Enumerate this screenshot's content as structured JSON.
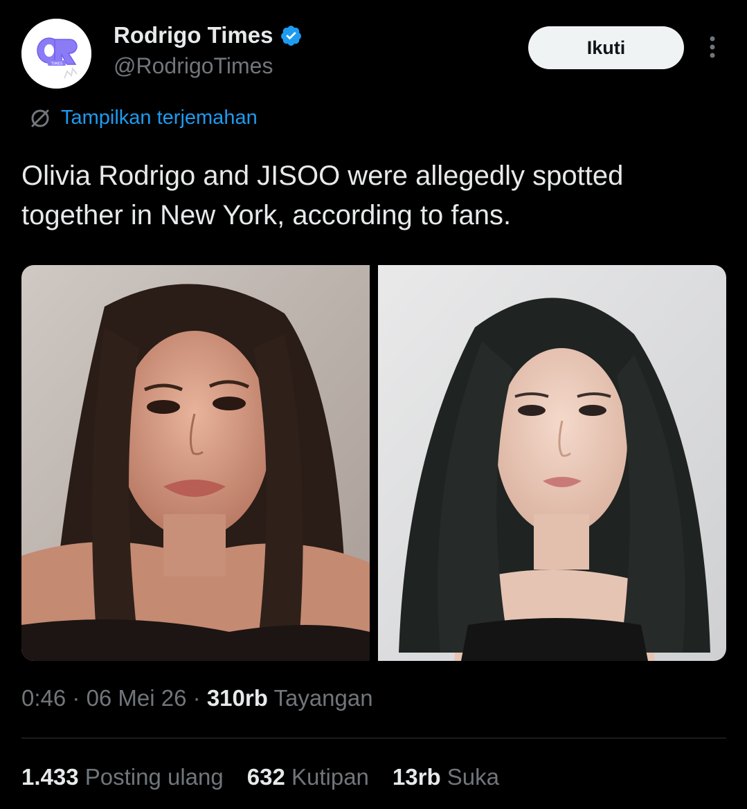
{
  "account": {
    "display_name": "Rodrigo Times",
    "handle": "@RodrigoTimes",
    "verified": true,
    "avatar_text": "OR",
    "avatar_subtext": "TIMES"
  },
  "actions": {
    "follow_label": "Ikuti",
    "more_icon": "more-vertical-icon"
  },
  "translation": {
    "label": "Tampilkan terjemahan",
    "icon": "translate-icon"
  },
  "tweet": {
    "text": "Olivia Rodrigo and JISOO were allegedly spotted together in New York, according to fans."
  },
  "media": [
    {
      "name": "photo-olivia-rodrigo"
    },
    {
      "name": "photo-jisoo"
    }
  ],
  "meta": {
    "time": "0:46",
    "sep1": " · ",
    "date": "06 Mei 26",
    "sep2": " · ",
    "views": "310rb",
    "views_label": " Tayangan"
  },
  "stats": {
    "reposts": {
      "count": "1.433",
      "label": " Posting ulang"
    },
    "quotes": {
      "count": "632",
      "label": " Kutipan"
    },
    "likes": {
      "count": "13rb",
      "label": " Suka"
    }
  },
  "colors": {
    "background": "#000000",
    "text": "#e7e9ea",
    "secondary": "#71767b",
    "link": "#1d9bf0",
    "verified": "#1d9bf0",
    "avatar_accent": "#8b7cf6"
  }
}
